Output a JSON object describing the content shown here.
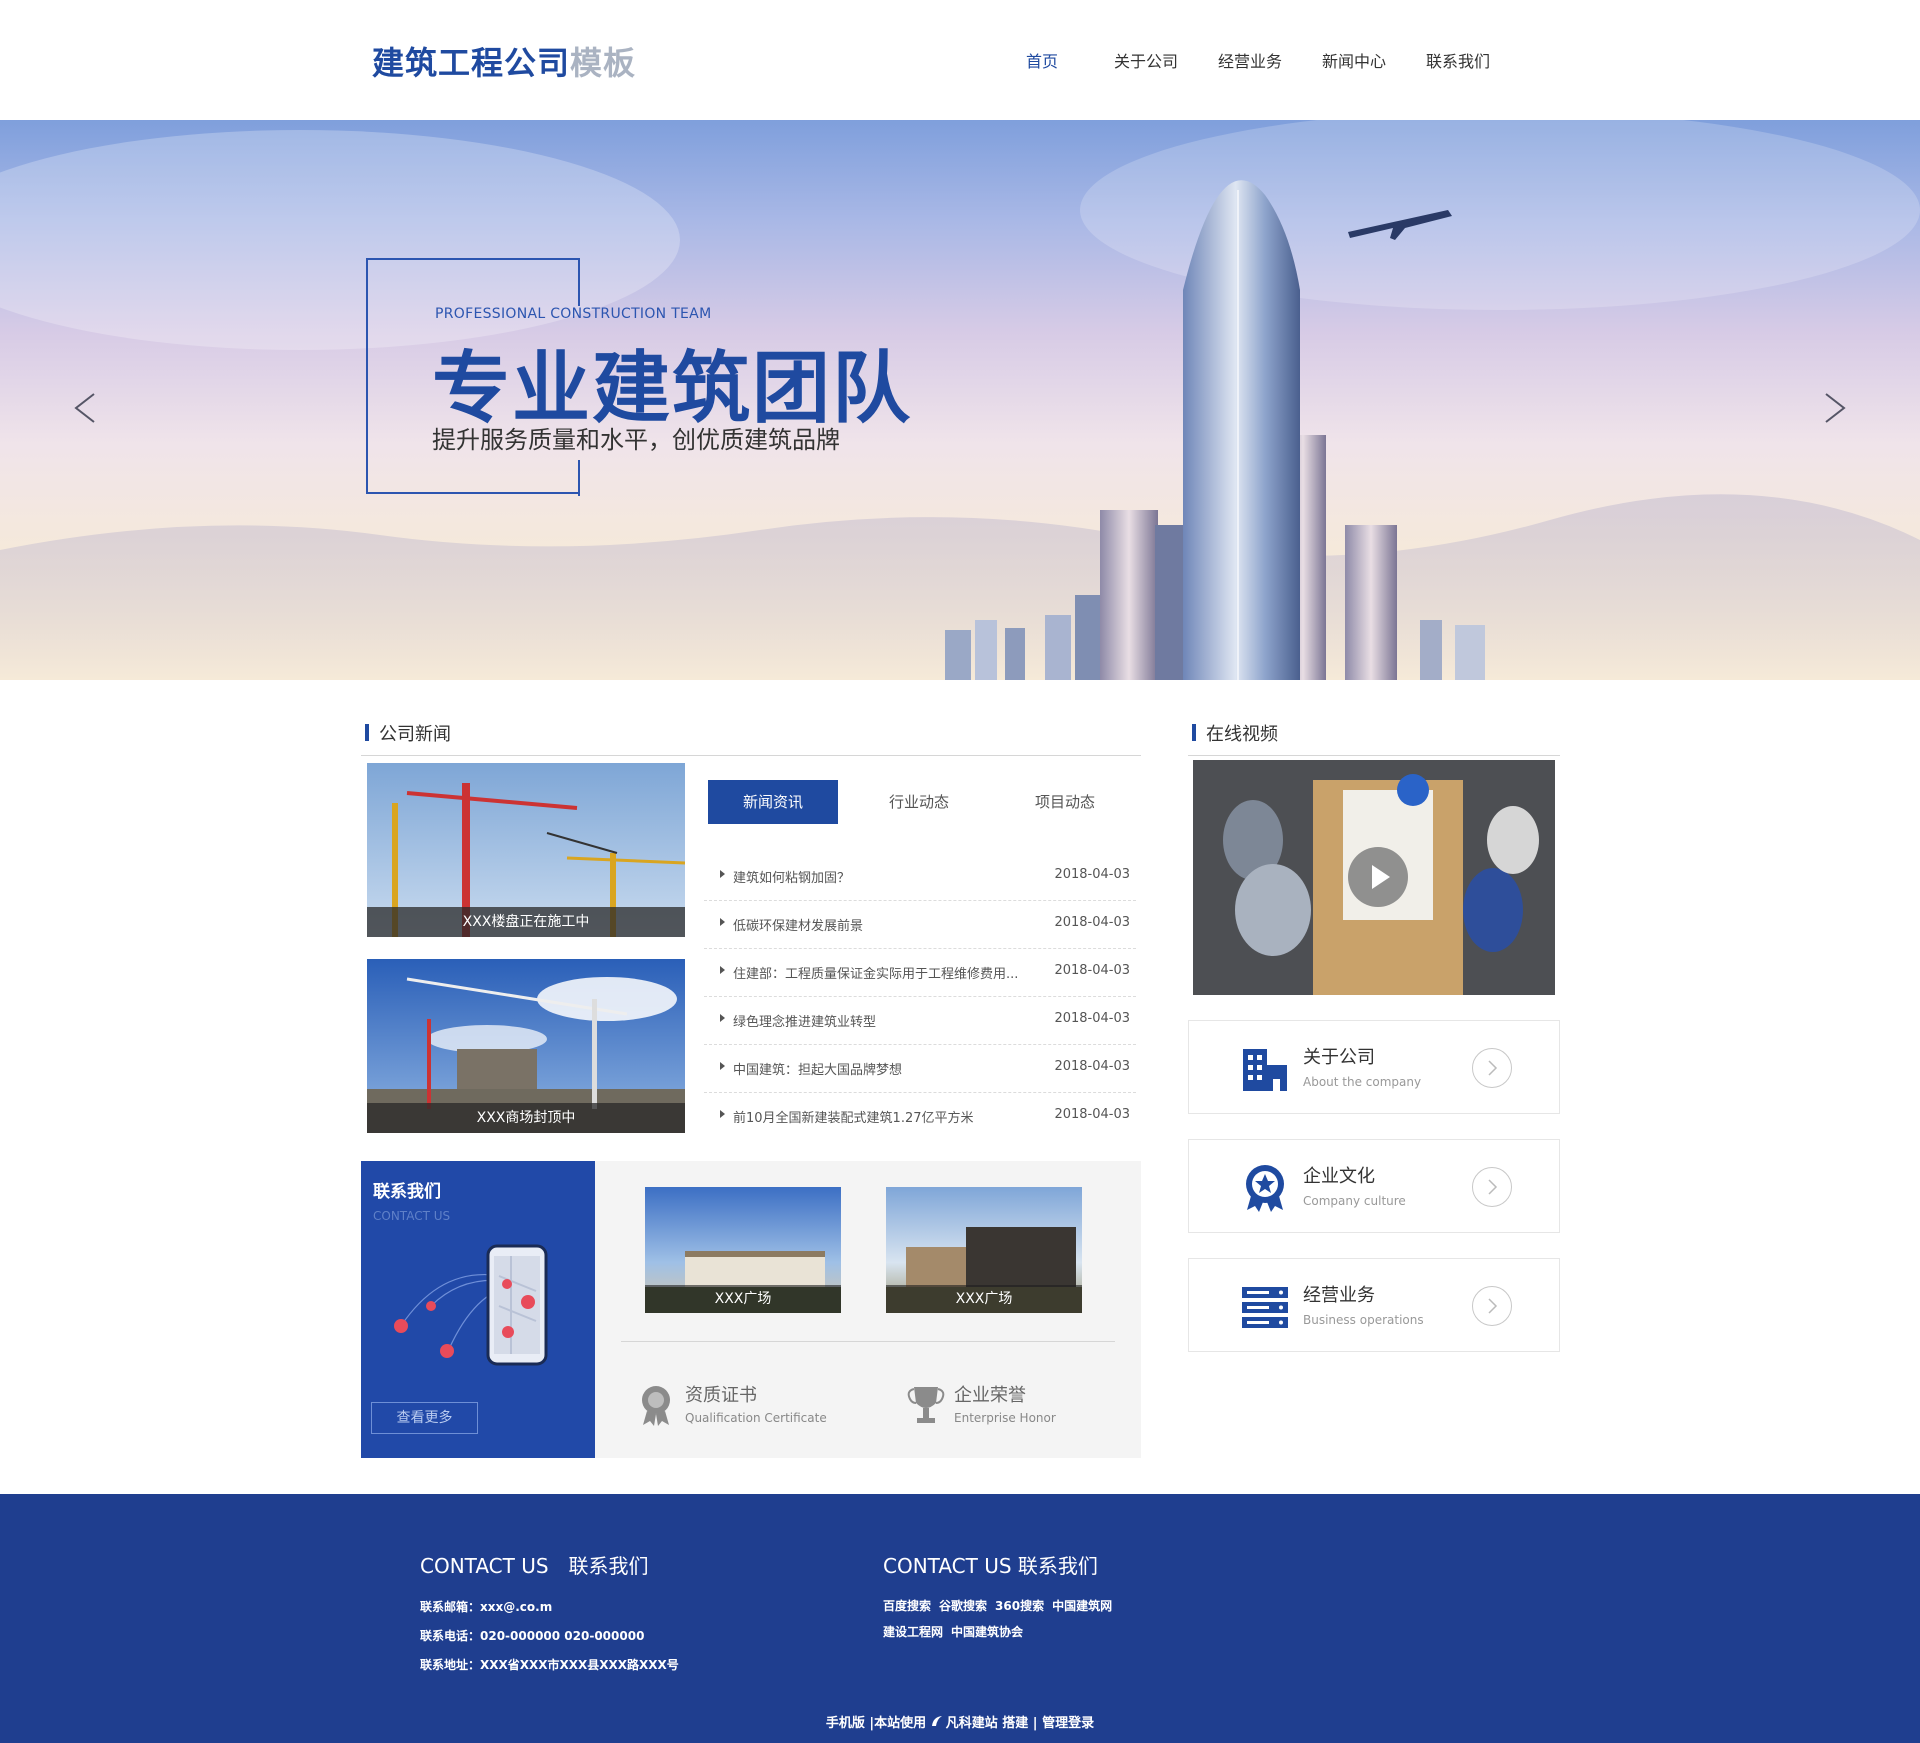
{
  "header": {
    "logo_main": "建筑工程公司",
    "logo_sub": "模板",
    "nav": [
      "首页",
      "关于公司",
      "经营业务",
      "新闻中心",
      "联系我们"
    ],
    "active_nav": "首页"
  },
  "banner": {
    "en": "PROFESSIONAL CONSTRUCTION TEAM",
    "title": "专业建筑团队",
    "subtitle": "提升服务质量和水平，创优质建筑品牌"
  },
  "news": {
    "section_title": "公司新闻",
    "photos": [
      {
        "caption": "XXX楼盘正在施工中"
      },
      {
        "caption": "XXX商场封顶中"
      }
    ],
    "tabs": [
      "新闻资讯",
      "行业动态",
      "项目动态"
    ],
    "active_tab": "新闻资讯",
    "items": [
      {
        "title": "建筑如何粘钢加固？",
        "date": "2018-04-03"
      },
      {
        "title": "低碳环保建材发展前景",
        "date": "2018-04-03"
      },
      {
        "title": "住建部：工程质量保证金实际用于工程维修费用...",
        "date": "2018-04-03"
      },
      {
        "title": "绿色理念推进建筑业转型",
        "date": "2018-04-03"
      },
      {
        "title": "中国建筑：担起大国品牌梦想",
        "date": "2018-04-03"
      },
      {
        "title": "前10月全国新建装配式建筑1.27亿平方米",
        "date": "2018-04-03"
      }
    ]
  },
  "contact_box": {
    "title": "联系我们",
    "en": "CONTACT US",
    "more": "查看更多"
  },
  "projects": [
    {
      "caption": "XXX广场"
    },
    {
      "caption": "XXX广场"
    }
  ],
  "honors": [
    {
      "title": "资质证书",
      "en": "Qualification Certificate",
      "icon": "medal-icon"
    },
    {
      "title": "企业荣誉",
      "en": "Enterprise Honor",
      "icon": "trophy-icon"
    }
  ],
  "video": {
    "section_title": "在线视频"
  },
  "cards": [
    {
      "title": "关于公司",
      "en": "About the company",
      "icon": "building-icon"
    },
    {
      "title": "企业文化",
      "en": "Company culture",
      "icon": "award-icon"
    },
    {
      "title": "经营业务",
      "en": "Business operations",
      "icon": "server-icon"
    }
  ],
  "footer": {
    "heading_left": "CONTACT US　联系我们",
    "heading_right": "CONTACT US 联系我们",
    "email": "联系邮箱：xxx@.co.m",
    "phone": "联系电话：020-000000 020-000000",
    "address": "联系地址：XXX省XXX市XXX县XXX路XXX号",
    "links_row1": [
      "百度搜索",
      "谷歌搜索",
      "360搜索",
      "中国建筑网"
    ],
    "links_row2": [
      "建设工程网",
      "中国建筑协会"
    ],
    "bottom_mobile": "手机版",
    "bottom_sep1": " |本站使用 ",
    "bottom_brand": "凡科建站",
    "bottom_build": " 搭建 ",
    "bottom_sep2": "| ",
    "bottom_admin": "管理登录"
  },
  "colors": {
    "brand_blue": "#1f4aa0",
    "footer_blue": "#1f3e8f",
    "contact_blue": "#2149a8"
  }
}
